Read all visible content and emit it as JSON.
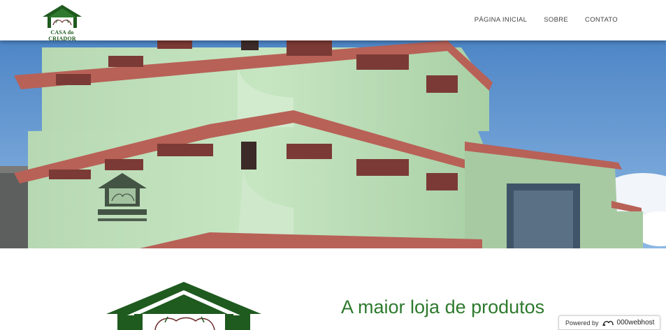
{
  "brand": {
    "logo_text": "CASA do CRIADOR",
    "color": "#1f5a1f"
  },
  "nav": {
    "items": [
      {
        "label": "PÁGINA INICIAL"
      },
      {
        "label": "SOBRE"
      },
      {
        "label": "CONTATO"
      }
    ]
  },
  "main": {
    "headline": "A maior loja de produtos"
  },
  "badge": {
    "prefix": "Powered by",
    "brand": "000webhost"
  },
  "colors": {
    "accent_green": "#2e7a2e",
    "building": "#bfe0bb",
    "trim": "#b86157",
    "sky": "#6f9fd2"
  }
}
